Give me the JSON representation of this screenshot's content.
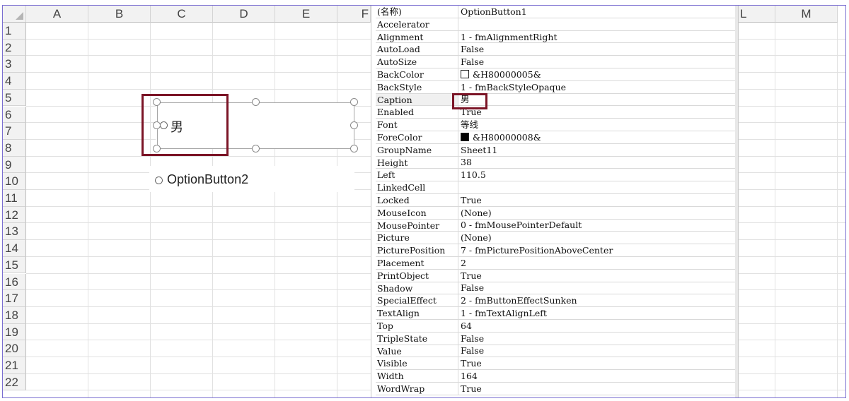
{
  "columns": [
    "A",
    "B",
    "C",
    "D",
    "E",
    "F",
    "L",
    "M"
  ],
  "rows": [
    "1",
    "2",
    "3",
    "4",
    "5",
    "6",
    "7",
    "8",
    "9",
    "10",
    "11",
    "12",
    "13",
    "14",
    "15",
    "16",
    "17",
    "18",
    "19",
    "20",
    "21",
    "22"
  ],
  "sheet": {
    "option_button1_caption": "男",
    "option_button2_caption": "OptionButton2"
  },
  "properties": [
    {
      "name": "(名称)",
      "value": "OptionButton1"
    },
    {
      "name": "Accelerator",
      "value": ""
    },
    {
      "name": "Alignment",
      "value": "1 - fmAlignmentRight"
    },
    {
      "name": "AutoLoad",
      "value": "False"
    },
    {
      "name": "AutoSize",
      "value": "False"
    },
    {
      "name": "BackColor",
      "value": "&H80000005&",
      "swatch": "#ffffff"
    },
    {
      "name": "BackStyle",
      "value": "1 - fmBackStyleOpaque"
    },
    {
      "name": "Caption",
      "value": "男",
      "selected": true
    },
    {
      "name": "Enabled",
      "value": "True"
    },
    {
      "name": "Font",
      "value": "等线"
    },
    {
      "name": "ForeColor",
      "value": "&H80000008&",
      "swatch": "#000000"
    },
    {
      "name": "GroupName",
      "value": "Sheet11"
    },
    {
      "name": "Height",
      "value": "38"
    },
    {
      "name": "Left",
      "value": "110.5"
    },
    {
      "name": "LinkedCell",
      "value": ""
    },
    {
      "name": "Locked",
      "value": "True"
    },
    {
      "name": "MouseIcon",
      "value": "(None)"
    },
    {
      "name": "MousePointer",
      "value": "0 - fmMousePointerDefault"
    },
    {
      "name": "Picture",
      "value": "(None)"
    },
    {
      "name": "PicturePosition",
      "value": "7 - fmPicturePositionAboveCenter"
    },
    {
      "name": "Placement",
      "value": "2"
    },
    {
      "name": "PrintObject",
      "value": "True"
    },
    {
      "name": "Shadow",
      "value": "False"
    },
    {
      "name": "SpecialEffect",
      "value": "2 - fmButtonEffectSunken"
    },
    {
      "name": "TextAlign",
      "value": "1 - fmTextAlignLeft"
    },
    {
      "name": "Top",
      "value": "64"
    },
    {
      "name": "TripleState",
      "value": "False"
    },
    {
      "name": "Value",
      "value": "False"
    },
    {
      "name": "Visible",
      "value": "True"
    },
    {
      "name": "Width",
      "value": "164"
    },
    {
      "name": "WordWrap",
      "value": "True"
    }
  ],
  "colors": {
    "highlight_border": "#7b1426",
    "frame_border": "#7b6fd1"
  }
}
